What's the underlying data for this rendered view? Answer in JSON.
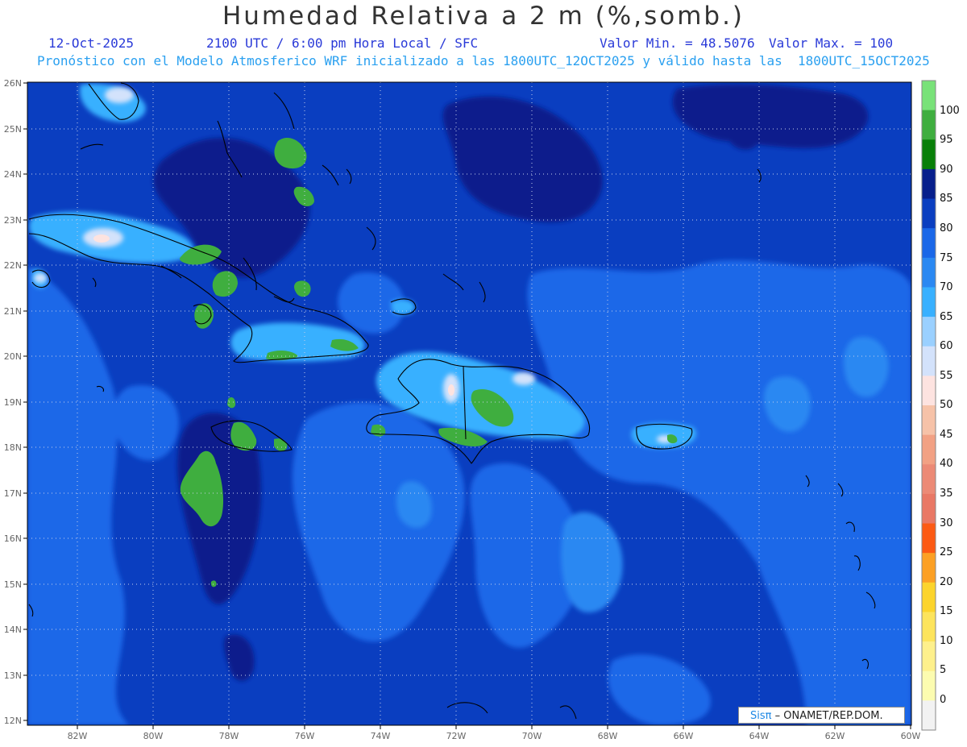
{
  "header": {
    "title": "Humedad Relativa a 2 m (%,somb.)",
    "date": "12-Oct-2025",
    "time": "2100 UTC / 6:00 pm Hora Local / SFC",
    "min_label": "Valor Min. = 48.5076",
    "max_label": "Valor Max. = 100",
    "model_line": "Pronóstico con el Modelo Atmosferico WRF inicializado a las 1800UTC_12OCT2025 y válido hasta las  1800UTC_15OCT2025"
  },
  "map": {
    "lon_labels": [
      "82W",
      "80W",
      "78W",
      "76W",
      "74W",
      "72W",
      "70W",
      "68W",
      "66W",
      "64W",
      "62W",
      "60W"
    ],
    "lat_labels": [
      "26N",
      "25N",
      "24N",
      "23N",
      "22N",
      "21N",
      "20N",
      "19N",
      "18N",
      "17N",
      "16N",
      "15N",
      "14N",
      "13N",
      "12N"
    ],
    "lon_range": [
      -83.2,
      -60
    ],
    "lat_range": [
      12,
      26
    ],
    "credit_brand": "Sisπ",
    "credit_text": " – ONAMET/REP.DOM."
  },
  "colorbar": {
    "labels": [
      "100",
      "95",
      "90",
      "85",
      "80",
      "75",
      "70",
      "65",
      "60",
      "55",
      "50",
      "45",
      "40",
      "35",
      "30",
      "25",
      "20",
      "15",
      "10",
      "5",
      "0"
    ],
    "colors": [
      "#79e279",
      "#3fae3f",
      "#087f08",
      "#071f8c",
      "#0a3ec0",
      "#1a67e8",
      "#2a88f2",
      "#38b0ff",
      "#9ad0ff",
      "#d3e2fb",
      "#fde3e0",
      "#f6c2a8",
      "#f2a184",
      "#ec8a76",
      "#e97865",
      "#fc5a14",
      "#fca024",
      "#fcd42c",
      "#fde45c",
      "#fef08c",
      "#fcfcb0",
      "#f2f2f2"
    ]
  },
  "chart_data": {
    "type": "heatmap",
    "title": "Humedad Relativa a 2 m (%,somb.)",
    "valor_min": 48.5076,
    "valor_max": 100,
    "x_ticks": [
      "82W",
      "80W",
      "78W",
      "76W",
      "74W",
      "72W",
      "70W",
      "68W",
      "66W",
      "64W",
      "62W",
      "60W"
    ],
    "y_ticks": [
      "12N",
      "13N",
      "14N",
      "15N",
      "16N",
      "17N",
      "18N",
      "19N",
      "20N",
      "21N",
      "22N",
      "23N",
      "24N",
      "25N",
      "26N"
    ],
    "legend_levels": [
      0,
      5,
      10,
      15,
      20,
      25,
      30,
      35,
      40,
      45,
      50,
      55,
      60,
      65,
      70,
      75,
      80,
      85,
      90,
      95,
      100
    ]
  }
}
